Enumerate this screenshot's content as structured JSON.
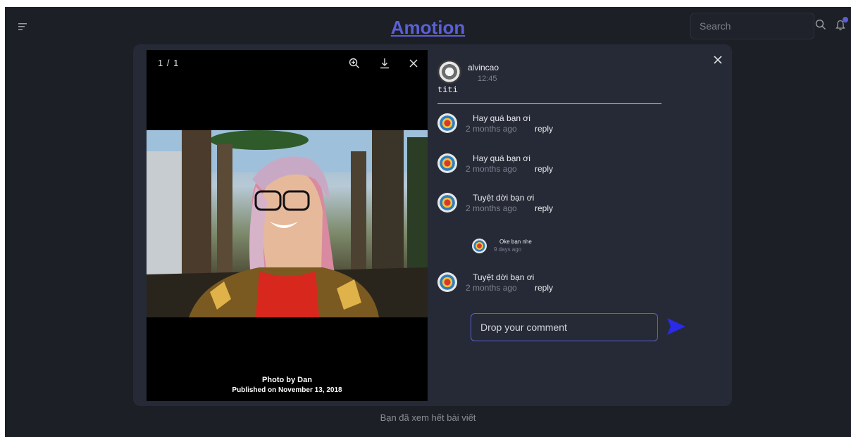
{
  "header": {
    "brand": "Amotion",
    "search_placeholder": "Search",
    "icons": [
      "menu-icon",
      "search-icon",
      "bell-icon"
    ],
    "accent_color": "#5b5fd6"
  },
  "viewer": {
    "counter": "1 / 1",
    "tools": [
      "zoom-in-icon",
      "download-icon",
      "close-icon"
    ],
    "caption_line1": "Photo by Dan",
    "caption_line2": "Published on November 13, 2018"
  },
  "post": {
    "author": "alvincao",
    "time": "12:45",
    "text": "titi"
  },
  "comments": [
    {
      "text": "Hay quá bạn ơi",
      "ago": "2 months ago",
      "reply_label": "reply"
    },
    {
      "text": "Hay quá bạn ơi",
      "ago": "2 months ago",
      "reply_label": "reply"
    },
    {
      "text": "Tuyệt dời bạn ơi",
      "ago": "2 months ago",
      "reply_label": "reply"
    },
    {
      "text": "Tuyệt dời bạn ơi",
      "ago": "2 months ago",
      "reply_label": "reply"
    }
  ],
  "reply": {
    "text": "Oke bạn nhe",
    "ago": "9 days ago"
  },
  "comment_box": {
    "placeholder": "Drop your comment",
    "send_icon": "send-icon"
  },
  "footer": {
    "text": "Bạn đã xem hết bài viết"
  }
}
